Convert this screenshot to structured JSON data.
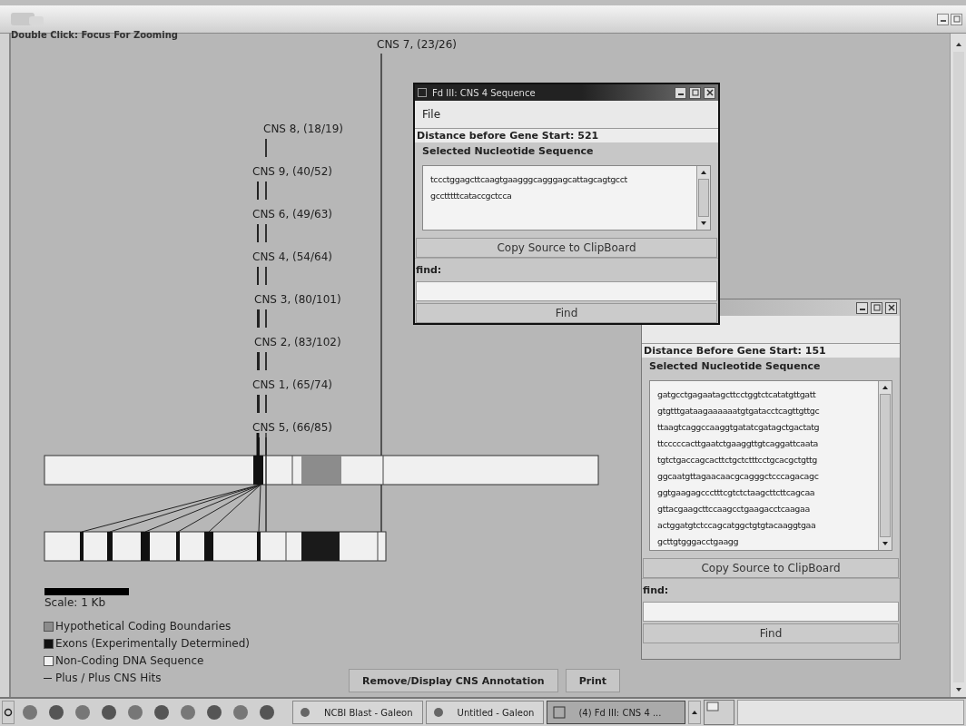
{
  "window": {
    "hint": "Double Click: Focus For Zooming"
  },
  "diagram": {
    "top_label": "CNS 7, (23/26)",
    "cns_labels": [
      {
        "label": "CNS 8, (18/19)",
        "pair": false
      },
      {
        "label": "CNS 9, (40/52)",
        "pair": true
      },
      {
        "label": "CNS 6, (49/63)",
        "pair": true
      },
      {
        "label": "CNS 4, (54/64)",
        "pair": true
      },
      {
        "label": "CNS 3, (80/101)",
        "pair": true
      },
      {
        "label": "CNS 2, (83/102)",
        "pair": true
      },
      {
        "label": "CNS 1, (65/74)",
        "pair": true
      },
      {
        "label": "CNS 5, (66/85)",
        "pair": true
      }
    ],
    "scale_label": "Scale:  1 Kb",
    "legend": [
      {
        "kind": "hypothetical",
        "label": "Hypothetical Coding Boundaries"
      },
      {
        "kind": "exon",
        "label": "Exons (Experimentally Determined)"
      },
      {
        "kind": "noncoding",
        "label": "Non-Coding DNA Sequence"
      },
      {
        "kind": "hit",
        "label": "Plus / Plus CNS Hits"
      }
    ]
  },
  "buttons": [
    "Remove/Display CNS Annotation",
    "Print"
  ],
  "sequence_windows": [
    {
      "title": "Fd III: CNS 4 Sequence",
      "menu": [
        "File"
      ],
      "distance": "Distance before Gene Start: 521",
      "section": "Selected Nucleotide Sequence",
      "sequence": [
        "tccctggagcttcaagtgaagggcagggagcattagcagtgcct",
        "gcctttttcataccgctcca"
      ],
      "copy_button": "Copy Source to ClipBoard",
      "find_label": "find:",
      "find_button": "Find"
    },
    {
      "distance": "Distance Before Gene Start: 151",
      "section": "Selected Nucleotide Sequence",
      "sequence": [
        "gatgcctgagaatagcttcctggtctcatatgttgatt",
        "gtgtttgataagaaaaaatgtgatacctcagttgttgc",
        "ttaagtcaggccaaggtgatatcgatagctgactatg",
        "ttcccccacttgaatctgaaggttgtcaggattcaata",
        "tgtctgaccagcacttctgctctttcctgcacgctgttg",
        "ggcaatgttagaacaacgcagggctcccagacagc",
        "ggtgaagagccctttcgtctctaagcttcttcagcaa",
        "gttacgaagcttccaagcctgaagacctcaagaa",
        "actggatgtctccagcatggctgtgtacaaggtgaa",
        "gcttgtgggacctgaagg"
      ],
      "copy_button": "Copy Source to ClipBoard",
      "find_label": "find:",
      "find_button": "Find"
    }
  ],
  "taskbar": {
    "tasks": [
      {
        "label": "NCBI Blast - Galeon",
        "selected": false
      },
      {
        "label": "Untitled - Galeon",
        "selected": false
      },
      {
        "label": "(4) Fd III: CNS 4 ...",
        "selected": true
      }
    ]
  }
}
